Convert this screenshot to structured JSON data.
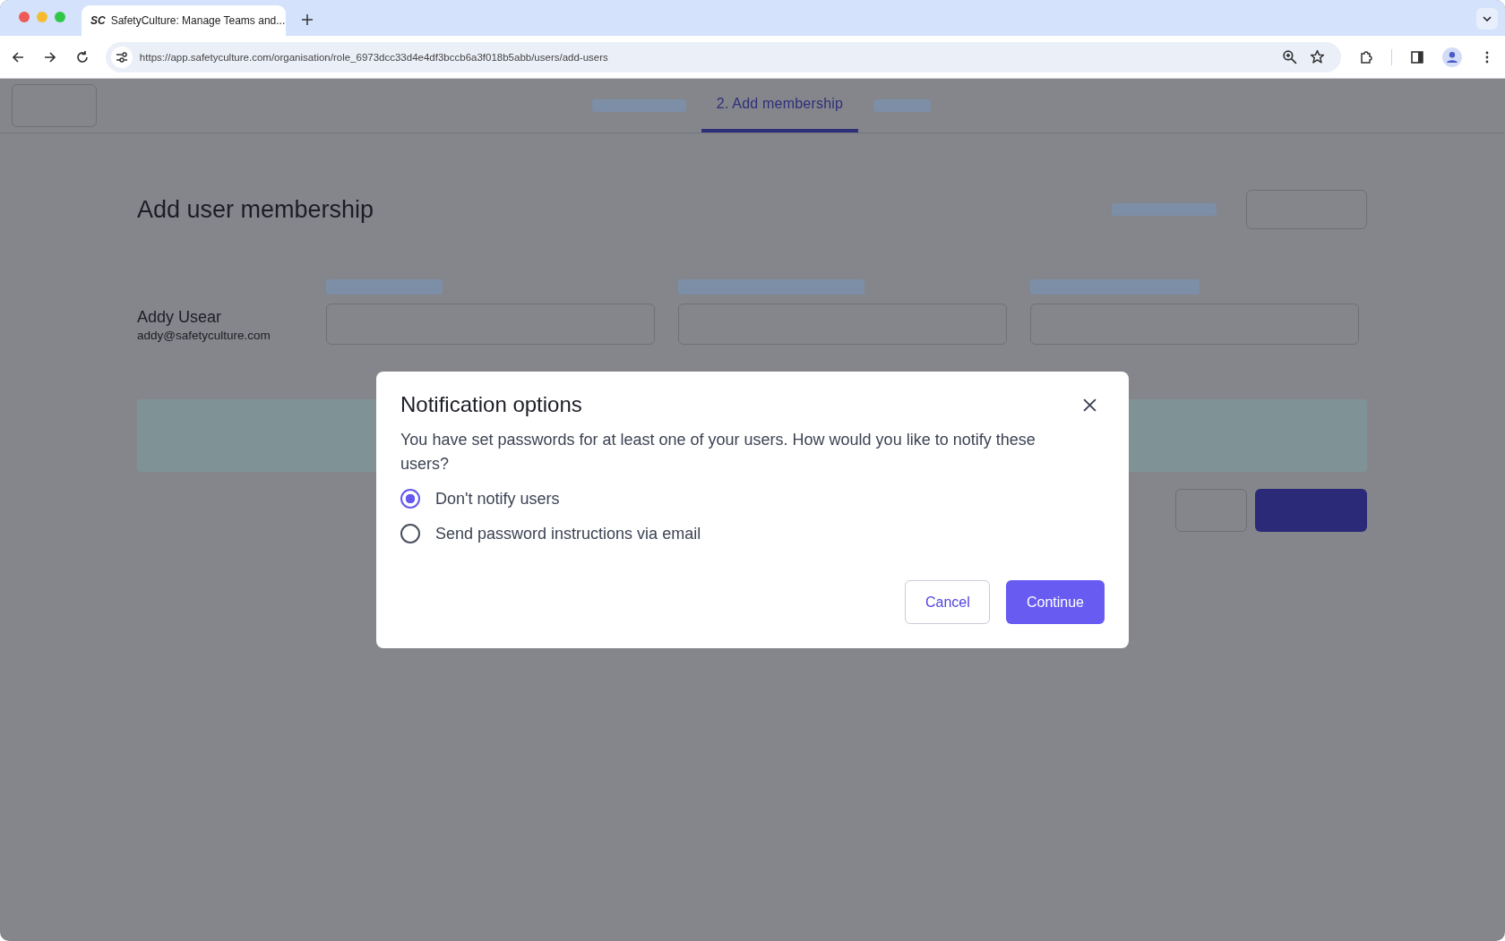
{
  "browser": {
    "tab_title": "SafetyCulture: Manage Teams and...",
    "tab_logo": "SC",
    "url": "https://app.safetyculture.com/organisation/role_6973dcc33d4e4df3bccb6a3f018b5abb/users/add-users"
  },
  "stepper": [
    {
      "kind": "skeleton",
      "selected": false
    },
    {
      "kind": "label",
      "label": "2. Add membership",
      "selected": true
    },
    {
      "kind": "skeleton",
      "selected": false
    }
  ],
  "page": {
    "title": "Add user membership",
    "user": {
      "name": "Addy Usear",
      "email": "addy@safetyculture.com"
    }
  },
  "dialog": {
    "title": "Notification options",
    "message": "You have set passwords for at least one of your users. How would you like to notify these users?",
    "options": [
      {
        "label": "Don't notify users",
        "selected": true
      },
      {
        "label": "Send password instructions via email",
        "selected": false
      }
    ],
    "buttons": [
      {
        "label": "Cancel",
        "kind": "secondary"
      },
      {
        "label": "Continue",
        "kind": "primary"
      }
    ]
  }
}
